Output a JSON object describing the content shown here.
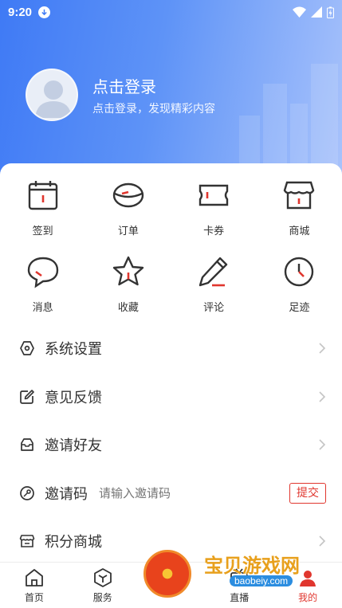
{
  "status_bar": {
    "time": "9:20"
  },
  "profile": {
    "title": "点击登录",
    "subtitle": "点击登录，发现精彩内容"
  },
  "quick_grid": [
    {
      "label": "签到",
      "icon": "calendar-icon"
    },
    {
      "label": "订单",
      "icon": "order-icon"
    },
    {
      "label": "卡券",
      "icon": "ticket-icon"
    },
    {
      "label": "商城",
      "icon": "shop-icon"
    },
    {
      "label": "消息",
      "icon": "message-icon"
    },
    {
      "label": "收藏",
      "icon": "star-icon"
    },
    {
      "label": "评论",
      "icon": "pencil-icon"
    },
    {
      "label": "足迹",
      "icon": "clock-icon"
    }
  ],
  "menu": {
    "settings": "系统设置",
    "feedback": "意见反馈",
    "invite_friends": "邀请好友",
    "invite_code": {
      "label": "邀请码",
      "placeholder": "请输入邀请码",
      "submit": "提交"
    },
    "points_mall": "积分商城"
  },
  "tabbar": {
    "tabs": [
      {
        "label": "首页",
        "icon": "home-icon"
      },
      {
        "label": "服务",
        "icon": "service-icon"
      },
      {
        "label": "",
        "icon": "center-icon"
      },
      {
        "label": "直播",
        "icon": "live-icon"
      },
      {
        "label": "我的",
        "icon": "user-icon",
        "active": true
      }
    ]
  },
  "watermark": {
    "text": "宝贝游戏网",
    "url": "baobeiy.com"
  },
  "colors": {
    "accent": "#e0362e",
    "hero_blue": "#3f7af5"
  }
}
